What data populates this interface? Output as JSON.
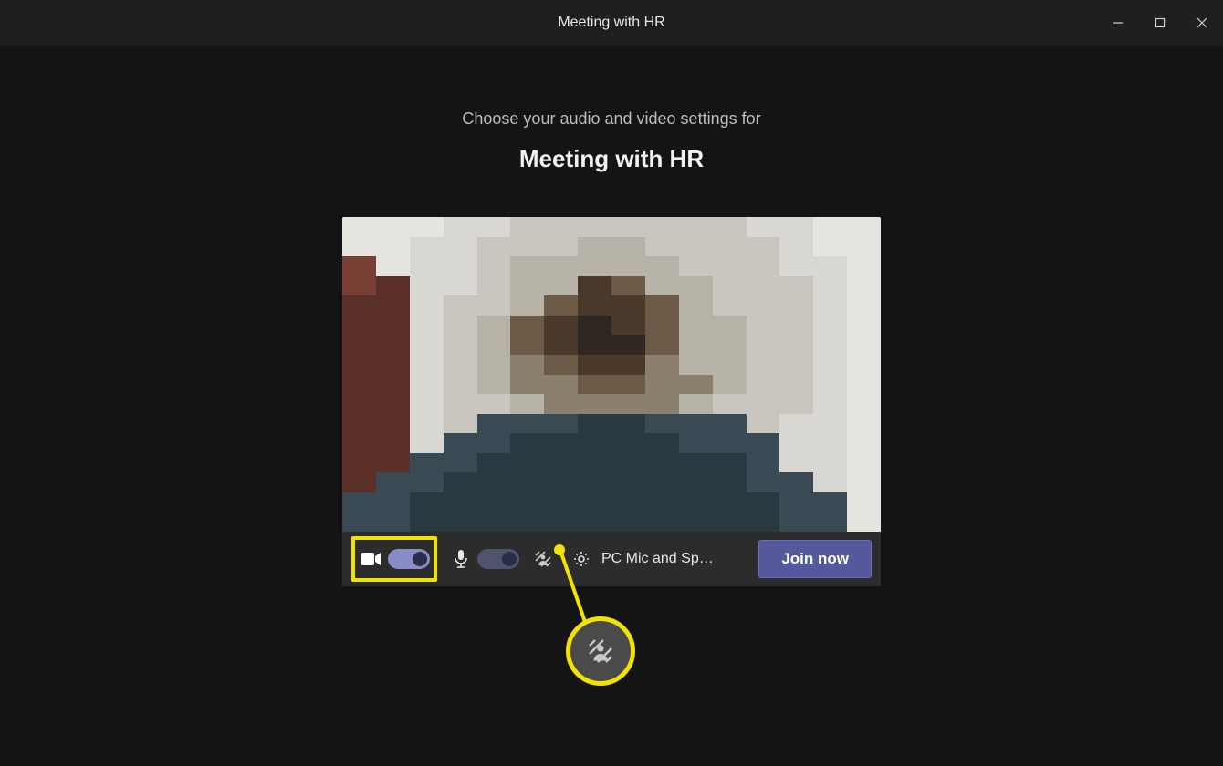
{
  "window": {
    "title": "Meeting with HR"
  },
  "prejoin": {
    "subtitle": "Choose your audio and video settings for",
    "meeting_name": "Meeting with HR",
    "device_label": "PC Mic and Sp…",
    "join_label": "Join now"
  },
  "colors": {
    "highlight": "#f2e200",
    "accent": "#55589a"
  }
}
